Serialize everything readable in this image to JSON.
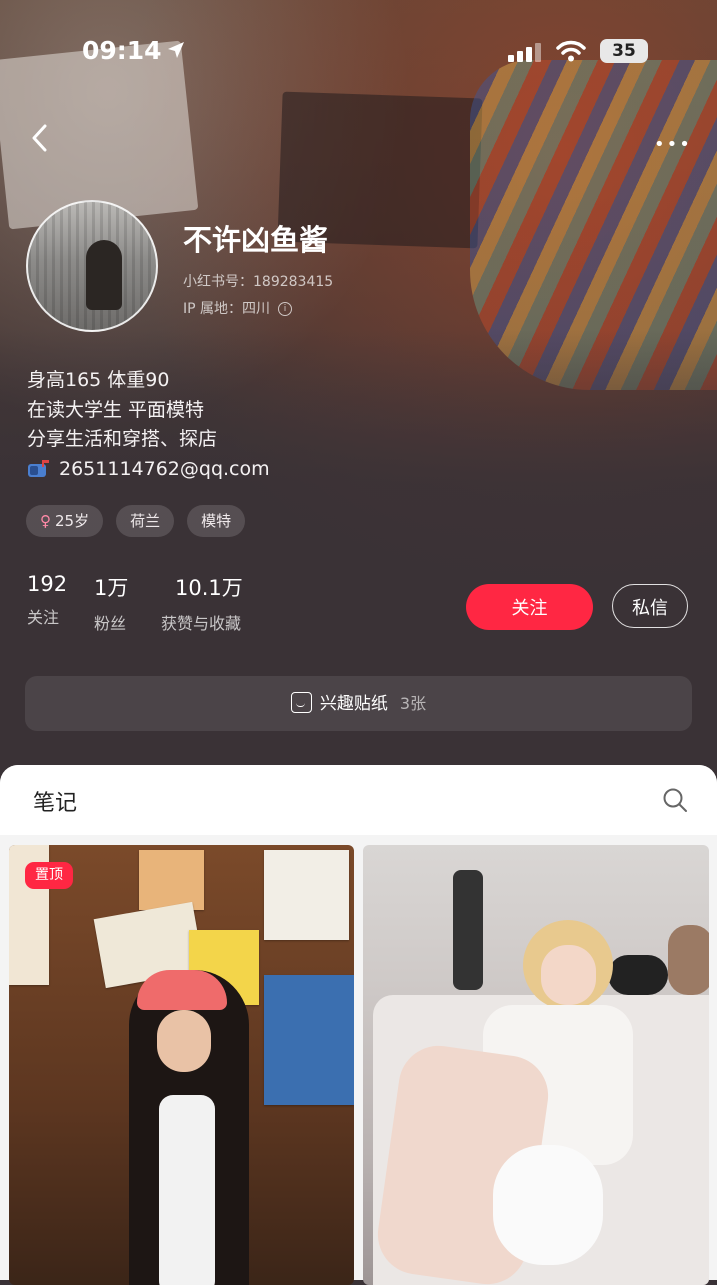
{
  "status_bar": {
    "time": "09:14",
    "battery": "35",
    "icons": [
      "location-arrow-icon",
      "signal-icon",
      "wifi-icon",
      "battery-icon"
    ]
  },
  "nav": {
    "back_icon": "chevron-left-icon",
    "more_label": "•••"
  },
  "profile": {
    "name": "不许凶鱼酱",
    "id_line": "小红书号：189283415",
    "ip_line": "IP 属地：四川",
    "info_icon": "i",
    "bio": [
      "身高165 体重90",
      "在读大学生 平面模特",
      "分享生活和穿搭、探店"
    ],
    "email": "2651114762@qq.com",
    "tags": {
      "gender_symbol": "♀",
      "age": "25岁",
      "location": "荷兰",
      "occupation": "模特"
    }
  },
  "stats": [
    {
      "num": "192",
      "label": "关注"
    },
    {
      "num": "1万",
      "label": "粉丝"
    },
    {
      "num": "10.1万",
      "label": "获赞与收藏"
    }
  ],
  "actions": {
    "follow": "关注",
    "message": "私信"
  },
  "stickers": {
    "label": "兴趣贴纸",
    "count": "3张"
  },
  "notes": {
    "title": "笔记",
    "pinned_badge": "置顶"
  },
  "colors": {
    "accent": "#ff2743",
    "background": "#3a3236",
    "panel": "#f4f4f4"
  }
}
